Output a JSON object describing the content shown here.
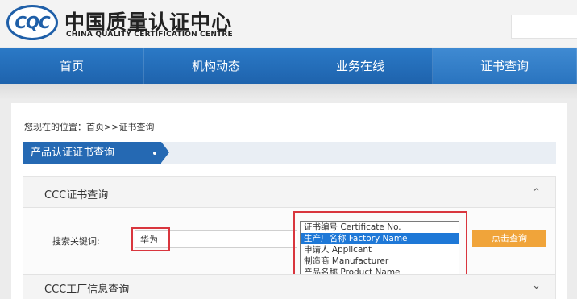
{
  "header": {
    "logo_text": "CQC",
    "org_name": "中国质量认证中心",
    "org_name_en": "CHINA QUALITY CERTIFICATION CENTRE"
  },
  "nav": {
    "items": [
      {
        "label": "首页"
      },
      {
        "label": "机构动态"
      },
      {
        "label": "业务在线"
      },
      {
        "label": "证书查询"
      }
    ],
    "active_index": 3
  },
  "breadcrumb": {
    "prefix": "您现在的位置：",
    "home": "首页",
    "sep": ">>",
    "current": "证书查询"
  },
  "section": {
    "title": "产品认证证书查询"
  },
  "panel": {
    "title": "CCC证书查询",
    "keyword_label": "搜索关键词:",
    "keyword_value": "华为",
    "search_button": "点击查询",
    "options": [
      {
        "label": "证书编号 Certificate No."
      },
      {
        "label": "生产厂名称 Factory Name"
      },
      {
        "label": "申请人 Applicant"
      },
      {
        "label": "制造商 Manufacturer"
      },
      {
        "label": "产品名称 Product Name"
      }
    ],
    "selected_index": 1
  },
  "panel2": {
    "title": "CCC工厂信息查询"
  },
  "icons": {
    "expand_up": "chevron-up-icon",
    "expand_down": "chevron-down-icon"
  },
  "colors": {
    "nav_blue": "#1e63ad",
    "accent_orange": "#f0a43a",
    "highlight_red": "#d9363e",
    "selected_blue": "#1e78d7"
  }
}
